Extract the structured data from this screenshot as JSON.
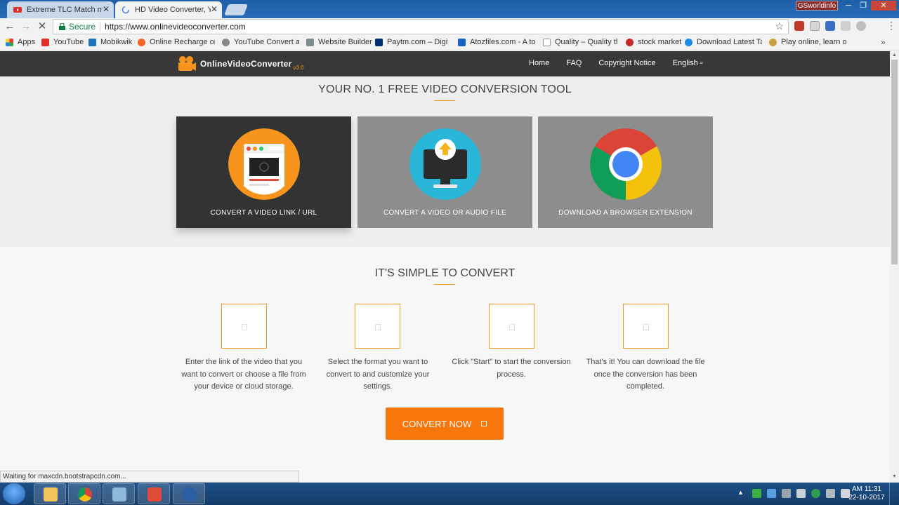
{
  "browser": {
    "tabs": [
      {
        "title": "Extreme TLC Match mon",
        "state": "inactive"
      },
      {
        "title": "HD Video Converter, You",
        "state": "active"
      }
    ],
    "profile_badge": "GSworldinfo",
    "secure_label": "Secure",
    "url": "https://www.onlinevideoconverter.com",
    "bookmarks": [
      "Apps",
      "YouTube",
      "Mobikwik",
      "Online Recharge on F",
      "YouTube Convert anc",
      "Website Builder",
      "Paytm.com – Digital",
      "Atozfiles.com - A to Z",
      "Quality – Quality the",
      "stock market",
      "Download Latest Tam",
      "Play online, learn onli"
    ],
    "status_text": "Waiting for maxcdn.bootstrapcdn.com..."
  },
  "site": {
    "logo_text": "OnlineVideoConverter",
    "logo_version": "v3.0",
    "nav": [
      "Home",
      "FAQ",
      "Copyright Notice",
      "English"
    ],
    "heading1": "YOUR NO. 1 FREE VIDEO CONVERSION TOOL",
    "cards": [
      {
        "label": "CONVERT A VIDEO LINK / URL",
        "icon": "video-link-icon",
        "selected": true
      },
      {
        "label": "CONVERT A VIDEO OR AUDIO FILE",
        "icon": "upload-monitor-icon",
        "selected": false
      },
      {
        "label": "DOWNLOAD A BROWSER EXTENSION",
        "icon": "chrome-icon",
        "selected": false
      }
    ],
    "heading2": "IT'S SIMPLE TO CONVERT",
    "steps": [
      "Enter the link of the video that you want to convert or choose a file from your device or cloud storage.",
      "Select the format you want to convert to and customize your settings.",
      "Click \"Start\" to start the conversion process.",
      "That's it! You can download the file once the conversion has been completed."
    ],
    "convert_button": "CONVERT NOW"
  },
  "taskbar": {
    "time": "AM 11:31",
    "date": "22-10-2017"
  },
  "colors": {
    "accent": "#f7941d",
    "button": "#f7770d",
    "nav_bg": "#383838",
    "card_bg": "#8d8d8d",
    "card_selected_bg": "#333333"
  }
}
